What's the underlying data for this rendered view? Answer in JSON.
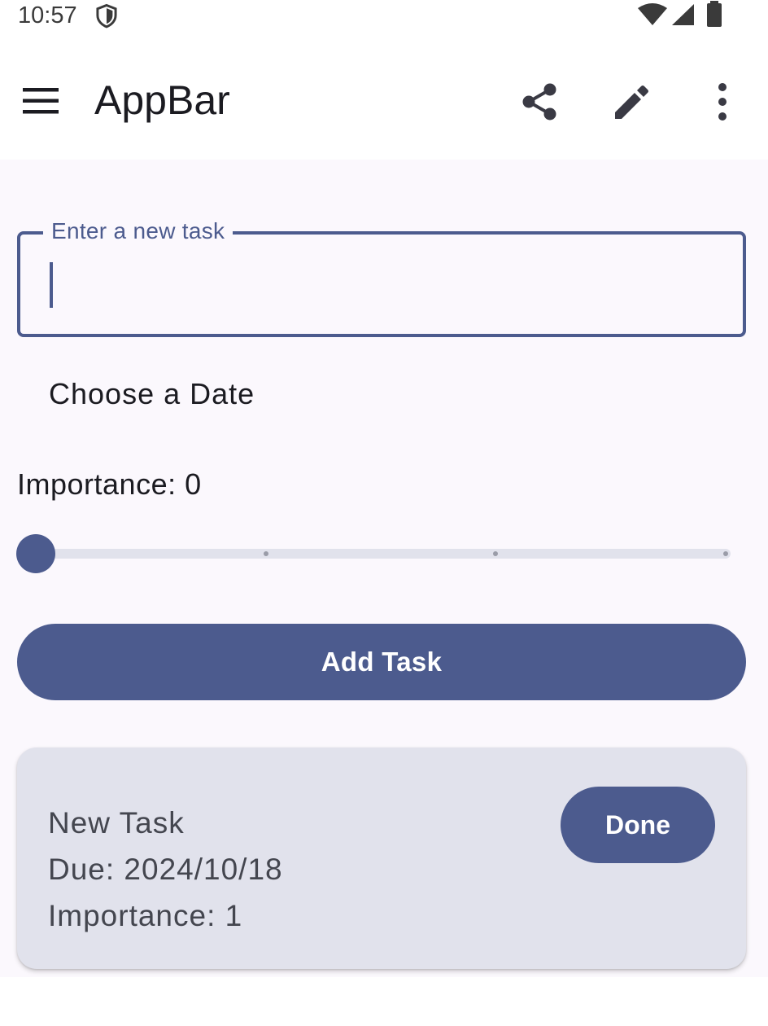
{
  "status_bar": {
    "time": "10:57",
    "icons": [
      "shield-icon",
      "wifi-icon",
      "signal-icon",
      "battery-icon"
    ]
  },
  "app_bar": {
    "title": "AppBar",
    "icons": [
      "menu-icon",
      "share-icon",
      "edit-icon",
      "more-vert-icon"
    ]
  },
  "form": {
    "task_field_label": "Enter a new task",
    "task_field_value": "",
    "choose_date_label": "Choose a Date",
    "importance_label": "Importance: 0",
    "importance_value": 0,
    "importance_max": 3,
    "add_button_label": "Add Task"
  },
  "tasks": [
    {
      "name": "New Task",
      "due": "Due: 2024/10/18",
      "importance": "Importance: 1",
      "done_label": "Done"
    }
  ],
  "colors": {
    "primary": "#4c5b8e",
    "background": "#fbf8fd",
    "card": "#e1e2ec",
    "on_surface": "#1b1b21",
    "on_surface_variant": "#44464f"
  }
}
